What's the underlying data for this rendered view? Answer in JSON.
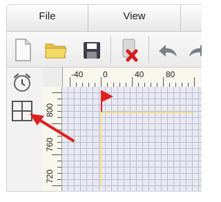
{
  "menubar": {
    "tabs": [
      {
        "label": "File"
      },
      {
        "label": "View"
      }
    ]
  },
  "toolbar": {
    "buttons": [
      {
        "name": "new-file-icon"
      },
      {
        "name": "open-folder-icon"
      },
      {
        "name": "save-icon"
      },
      {
        "name": "delete-icon"
      },
      {
        "name": "undo-icon"
      },
      {
        "name": "redo-icon"
      }
    ]
  },
  "left_tools": [
    {
      "name": "alarm-clock-icon"
    },
    {
      "name": "grid-layout-icon"
    }
  ],
  "ruler_h": {
    "labels": [
      "-40",
      "0",
      "40",
      "80"
    ]
  },
  "ruler_v": {
    "labels": [
      "800",
      "760",
      "720"
    ]
  },
  "colors": {
    "accent_arrow": "#e0201e",
    "flag": "#e0201e",
    "guide_line": "#f0e080",
    "grid_line": "#b9bdd0"
  }
}
